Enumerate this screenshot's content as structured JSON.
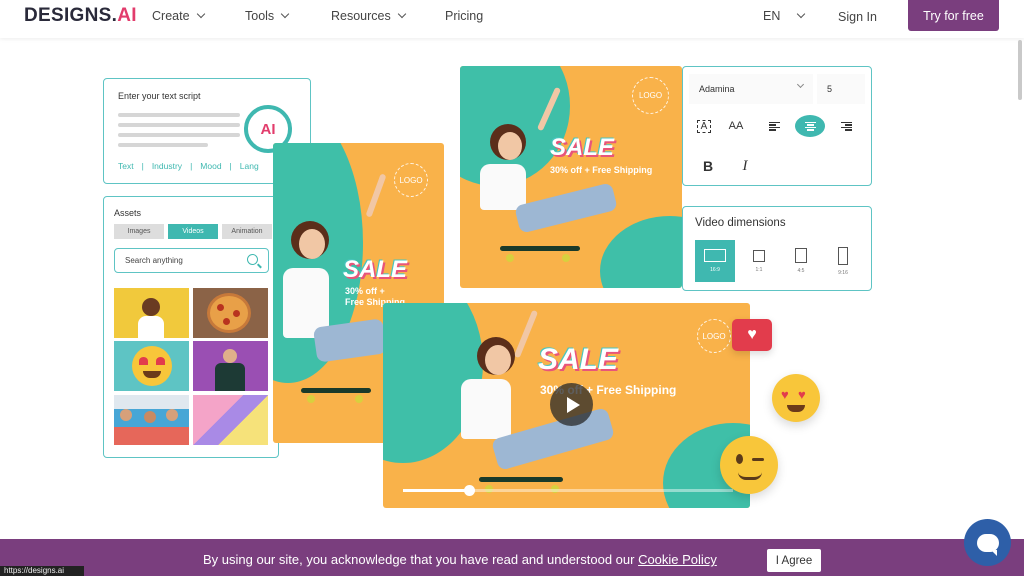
{
  "nav": {
    "logo_main": "DESIGNS.",
    "logo_ai": "AI",
    "items": [
      {
        "label": "Create"
      },
      {
        "label": "Tools"
      },
      {
        "label": "Resources"
      },
      {
        "label": "Pricing"
      }
    ],
    "language": "EN",
    "sign_in": "Sign In",
    "cta": "Try for free"
  },
  "script_panel": {
    "title": "Enter your text script",
    "tabs": [
      "Text",
      "Industry",
      "Mood",
      "Lang"
    ],
    "logo_letter": "AI"
  },
  "assets_panel": {
    "title": "Assets",
    "tabs": [
      "Images",
      "Videos",
      "Animation"
    ],
    "active_tab": "Videos",
    "search_placeholder": "Search anything"
  },
  "cards": {
    "logo": "LOGO",
    "sale": "SALE",
    "discount_line": "30% off + Free Shipping",
    "discount_line1": "30% off +",
    "discount_line2": "Free Shipping"
  },
  "font_panel": {
    "font_name": "Adamina",
    "font_size": "5",
    "bold": "B",
    "italic": "I",
    "text_box": "A",
    "text_size": "AA"
  },
  "dims_panel": {
    "title": "Video dimensions",
    "options": [
      "16:9",
      "1:1",
      "4:5",
      "9:16"
    ],
    "active": "16:9"
  },
  "video": {
    "progress": 0.2
  },
  "cookie": {
    "text": "By using our site, you acknowledge that you have read and understood our ",
    "link": "Cookie Policy",
    "agree": "I Agree"
  },
  "status_url": "https://designs.ai",
  "colors": {
    "brand_purple": "#7a3e7e",
    "teal": "#3fb8b0",
    "orange": "#f9b24a",
    "pink": "#e8557a"
  }
}
